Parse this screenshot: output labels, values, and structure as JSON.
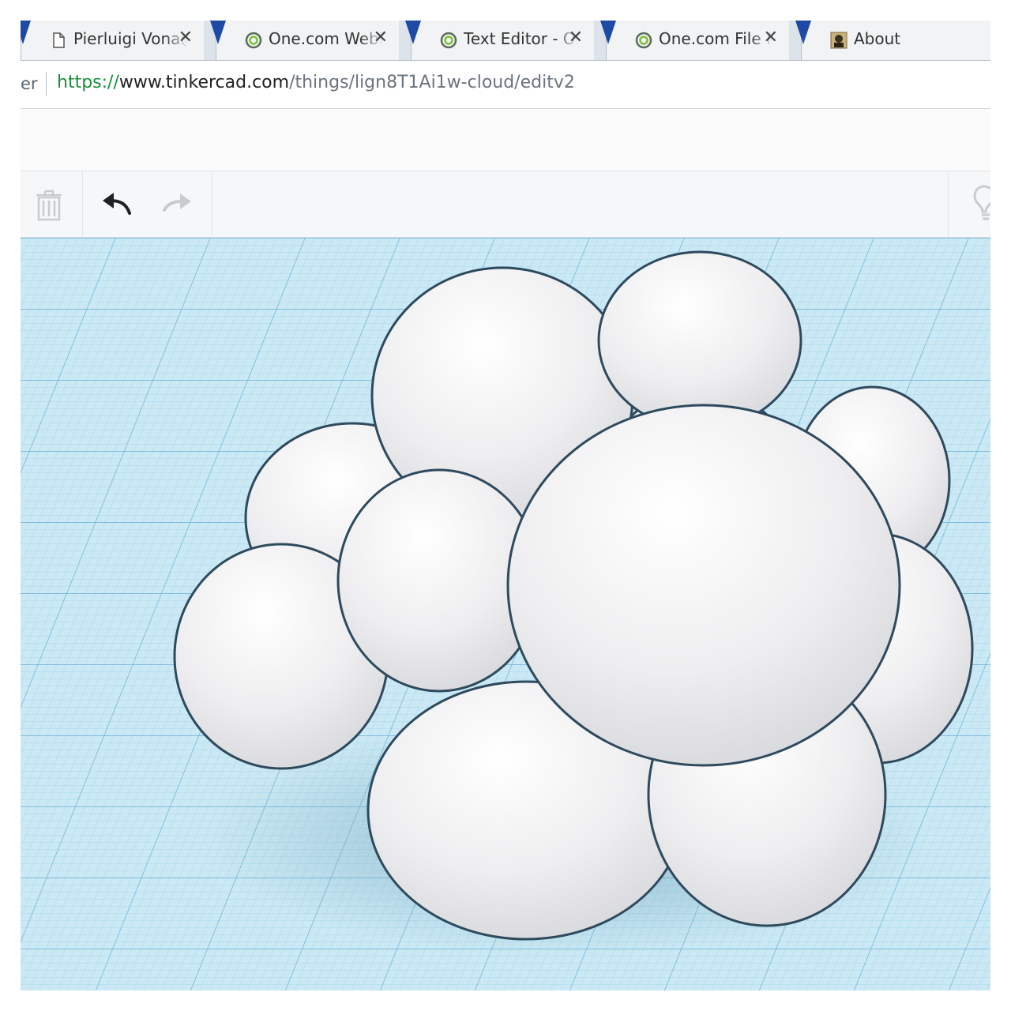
{
  "browser": {
    "tabs": [
      {
        "title": "Pierluigi Vona@",
        "icon": "document-icon"
      },
      {
        "title": "One.com Webhost",
        "icon": "onecom-icon"
      },
      {
        "title": "Text Editor - One",
        "icon": "onecom-icon"
      },
      {
        "title": "One.com File Ma",
        "icon": "onecom-icon"
      },
      {
        "title": "About",
        "icon": "avatar-icon"
      }
    ],
    "close_glyph": "✕",
    "address": {
      "left_fragment": "er",
      "scheme": "https://",
      "host": "www.tinkercad.com",
      "path": "/things/lign8T1Ai1w-cloud/editv2"
    }
  },
  "toolbar": {
    "buttons": [
      {
        "name": "delete",
        "icon": "trash-icon",
        "enabled": false
      },
      {
        "name": "undo",
        "icon": "undo-arrow-icon",
        "enabled": true
      },
      {
        "name": "redo",
        "icon": "redo-arrow-icon",
        "enabled": false
      },
      {
        "name": "hint",
        "icon": "lightbulb-icon",
        "enabled": true
      }
    ]
  },
  "workplane": {
    "object": "cloud",
    "colors": {
      "grid_background": "#cbe9f4",
      "grid_minor": "#a9d6ea",
      "grid_major": "#6fb6d8",
      "shape_fill": "#f1f1f3",
      "shape_outline": "#2e4a5e",
      "shadow": "#93bdd0"
    }
  }
}
